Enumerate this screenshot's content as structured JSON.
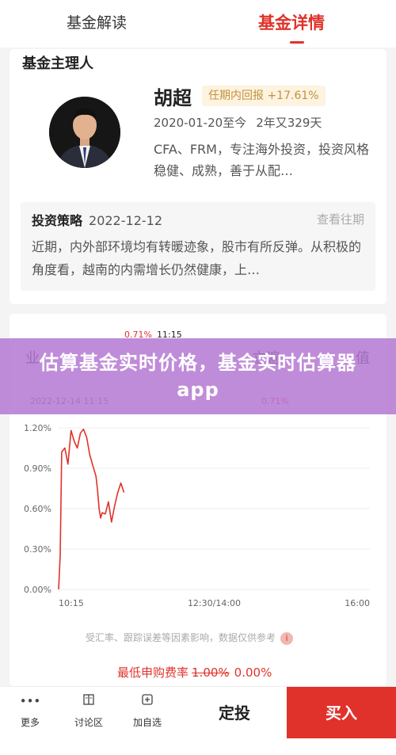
{
  "tabs": [
    {
      "label": "基金解读",
      "active": false
    },
    {
      "label": "基金详情",
      "active": true
    }
  ],
  "manager": {
    "section_title": "基金主理人",
    "name": "胡超",
    "badge": "任期内回报 +17.61%",
    "start_date": "2020-01-20至今",
    "duration": "2年又329天",
    "description": "CFA、FRM，专注海外投资，投资风格稳健、成熟，善于从配…"
  },
  "strategy": {
    "title": "投资策略",
    "date": "2022-12-12",
    "history_link": "查看往期",
    "body": "近期，内外部环境均有转暖迹象，股市有所反弹。从积极的角度看，越南的内需增长仍然健康，上…"
  },
  "chart_header": {
    "left_partial": "业",
    "right_partial": "值",
    "mid_partial": "立遍",
    "tooltip_pct": "0.71%",
    "tooltip_time": "11:15",
    "date_time": "2022-12-14 11:15",
    "est_pct": "0.71%"
  },
  "chart_data": {
    "type": "line",
    "ylim": [
      0.0,
      1.2
    ],
    "yticks": [
      "1.20%",
      "0.90%",
      "0.60%",
      "0.30%",
      "0.00%"
    ],
    "xticks": [
      "10:15",
      "12:30/14:00",
      "16:00"
    ],
    "series": [
      {
        "color": "#e0322b",
        "points": [
          [
            0.0,
            0.0
          ],
          [
            0.005,
            0.25
          ],
          [
            0.01,
            1.02
          ],
          [
            0.02,
            1.05
          ],
          [
            0.03,
            0.93
          ],
          [
            0.04,
            1.18
          ],
          [
            0.05,
            1.1
          ],
          [
            0.06,
            1.05
          ],
          [
            0.07,
            1.16
          ],
          [
            0.08,
            1.19
          ],
          [
            0.09,
            1.13
          ],
          [
            0.1,
            1.0
          ],
          [
            0.11,
            0.92
          ],
          [
            0.12,
            0.84
          ],
          [
            0.125,
            0.74
          ],
          [
            0.13,
            0.6
          ],
          [
            0.135,
            0.53
          ],
          [
            0.14,
            0.57
          ],
          [
            0.15,
            0.56
          ],
          [
            0.16,
            0.65
          ],
          [
            0.17,
            0.5
          ],
          [
            0.18,
            0.62
          ],
          [
            0.19,
            0.72
          ],
          [
            0.2,
            0.79
          ],
          [
            0.21,
            0.72
          ]
        ]
      }
    ]
  },
  "disclaimer": "受汇率、跟踪误差等因素影响，数据仅供参考",
  "info_icon": "i",
  "fee": {
    "label": "最低申购费率",
    "original": "1.00%",
    "current": "0.00%"
  },
  "banner": {
    "text": "估算基金实时价格，基金实时估算器app"
  },
  "bottom_bar": {
    "more": "更多",
    "discuss": "讨论区",
    "watchlist": "加自选",
    "dingtou": "定投",
    "buy": "买入"
  },
  "colors": {
    "accent": "#e0322b",
    "badge_text": "#c4923c",
    "badge_bg": "#fdf3e1",
    "banner": "#b478d2"
  }
}
